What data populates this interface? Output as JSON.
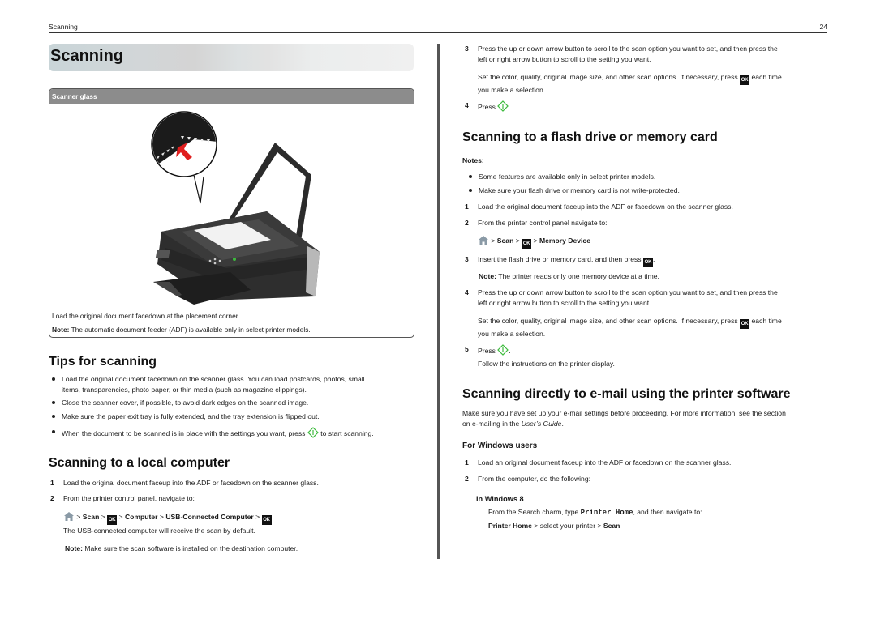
{
  "header": {
    "section": "Scanning",
    "page_number": "24"
  },
  "left": {
    "title": "Scanning",
    "figure": {
      "caption_title": "Scanner glass",
      "caption_line": "Load the original document facedown at the placement corner.",
      "note_label": "Note:",
      "note_text": " The automatic document feeder (ADF) is available only in select printer models.",
      "image": "printer-scanner-glass-illustration"
    },
    "tips": {
      "heading": "Tips for scanning",
      "bullets": [
        "Load the original document facedown on the scanner glass. You can load postcards, photos, small",
        "items, transparencies, photo paper, or thin media (such as magazine clippings).",
        "Close the scanner cover, if possible, to avoid dark edges on the scanned image.",
        "Make sure the paper exit tray is fully extended, and the tray extension is flipped out.",
        "When the document to be scanned is in place with the settings you want, press",
        " to start scanning."
      ]
    },
    "local": {
      "heading": "Scanning to a local computer",
      "step1": "Load the original document faceup into the ADF or facedown on the scanner glass.",
      "step2": "From the printer control panel, navigate to:",
      "path": {
        "sep": " > ",
        "scan": "Scan",
        "computer": "Computer",
        "usb": "USB-Connected Computer"
      },
      "after": "The USB-connected computer will receive the scan by default.",
      "note_label": "Note:",
      "note_text": " Make sure the scan software is installed on the destination computer."
    }
  },
  "right": {
    "cont": {
      "step3": "Press the up or down arrow button to scroll to the scan option you want to set, and then press the",
      "step3b": "left or right arrow button to scroll to the setting you want.",
      "set_a": "Set the color, quality, original image size, and other scan options. If necessary, press",
      "set_b": " each time",
      "set_c": "you make a selection.",
      "step4": "Press",
      "period": "."
    },
    "flash": {
      "heading": "Scanning to a flash drive or memory card",
      "notes_label": "Notes:",
      "notes": [
        "Some features are available only in select printer models.",
        "Make sure your flash drive or memory card is not write-protected."
      ],
      "step1": "Load the original document faceup into the ADF or facedown on the scanner glass.",
      "step2": "From the printer control panel navigate to:",
      "path": {
        "scan": "Scan",
        "memory": "Memory Device"
      },
      "step3": "Insert the flash drive or memory card, and then press",
      "note_label": "Note:",
      "note_text": " The printer reads only one memory device at a time.",
      "step4": "Press the up or down arrow button to scroll to the scan option you want to set, and then press the",
      "step4b": "left or right arrow button to scroll to the setting you want.",
      "set_a": "Set the color, quality, original image size, and other scan options. If necessary, press",
      "set_b": " each time",
      "set_c": "you make a selection.",
      "step5": "Press",
      "follow": "Follow the instructions on the printer display."
    },
    "email": {
      "heading": "Scanning directly to e-mail using the printer software",
      "intro_a": "Make sure you have set up your e-mail settings before proceeding. For more information, see the section",
      "intro_b": "on e-mailing in the ",
      "intro_guide": "User’s Guide",
      "intro_end": ".",
      "windows_heading": "For Windows users",
      "step1": "Load an original document faceup into the ADF or facedown on the scanner glass.",
      "step2": "From the computer, do the following:",
      "win8_heading": "In Windows 8",
      "win8_a": "From the Search charm, type ",
      "win8_code": "Printer Home",
      "win8_b": ", and then navigate to:",
      "win8_path_a": "Printer Home",
      "win8_path_b": " > select your printer > ",
      "win8_path_c": "Scan"
    }
  },
  "icons": {
    "ok_label": "OK",
    "start_color": "#3dbb3d",
    "home_color": "#8a9aa6"
  }
}
